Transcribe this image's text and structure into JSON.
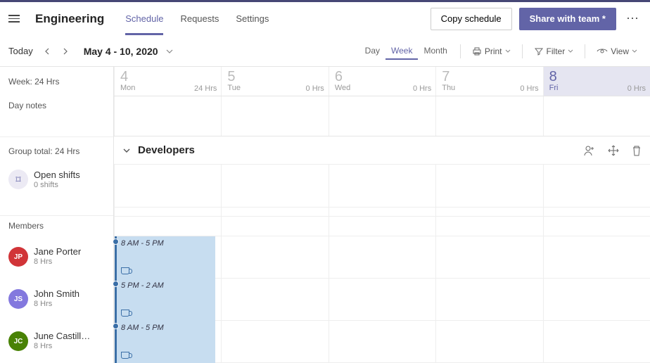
{
  "header": {
    "team": "Engineering",
    "tabs": [
      "Schedule",
      "Requests",
      "Settings"
    ],
    "copy": "Copy schedule",
    "share": "Share with team *"
  },
  "toolbar": {
    "today": "Today",
    "range": "May 4 - 10, 2020",
    "views": {
      "day": "Day",
      "week": "Week",
      "month": "Month"
    },
    "print": "Print",
    "filter": "Filter",
    "view": "View"
  },
  "side": {
    "weekHrs": "Week: 24 Hrs",
    "dayNotes": "Day notes",
    "groupTotal": "Group total: 24 Hrs",
    "openShifts": "Open shifts",
    "openShiftsSub": "0 shifts",
    "members": "Members"
  },
  "days": [
    {
      "num": "4",
      "abbr": "Mon",
      "hrs": "24 Hrs"
    },
    {
      "num": "5",
      "abbr": "Tue",
      "hrs": "0 Hrs"
    },
    {
      "num": "6",
      "abbr": "Wed",
      "hrs": "0 Hrs"
    },
    {
      "num": "7",
      "abbr": "Thu",
      "hrs": "0 Hrs"
    },
    {
      "num": "8",
      "abbr": "Fri",
      "hrs": "0 Hrs",
      "selected": true
    }
  ],
  "group": {
    "name": "Developers"
  },
  "members": [
    {
      "initials": "JP",
      "color": "#d13438",
      "name": "Jane Porter",
      "sub": "8 Hrs",
      "shift": "8 AM - 5 PM"
    },
    {
      "initials": "JS",
      "color": "#8378de",
      "name": "John Smith",
      "sub": "8 Hrs",
      "shift": "5 PM - 2 AM"
    },
    {
      "initials": "JC",
      "color": "#498205",
      "name": "June Castill…",
      "sub": "8 Hrs",
      "shift": "8 AM - 5 PM"
    }
  ]
}
